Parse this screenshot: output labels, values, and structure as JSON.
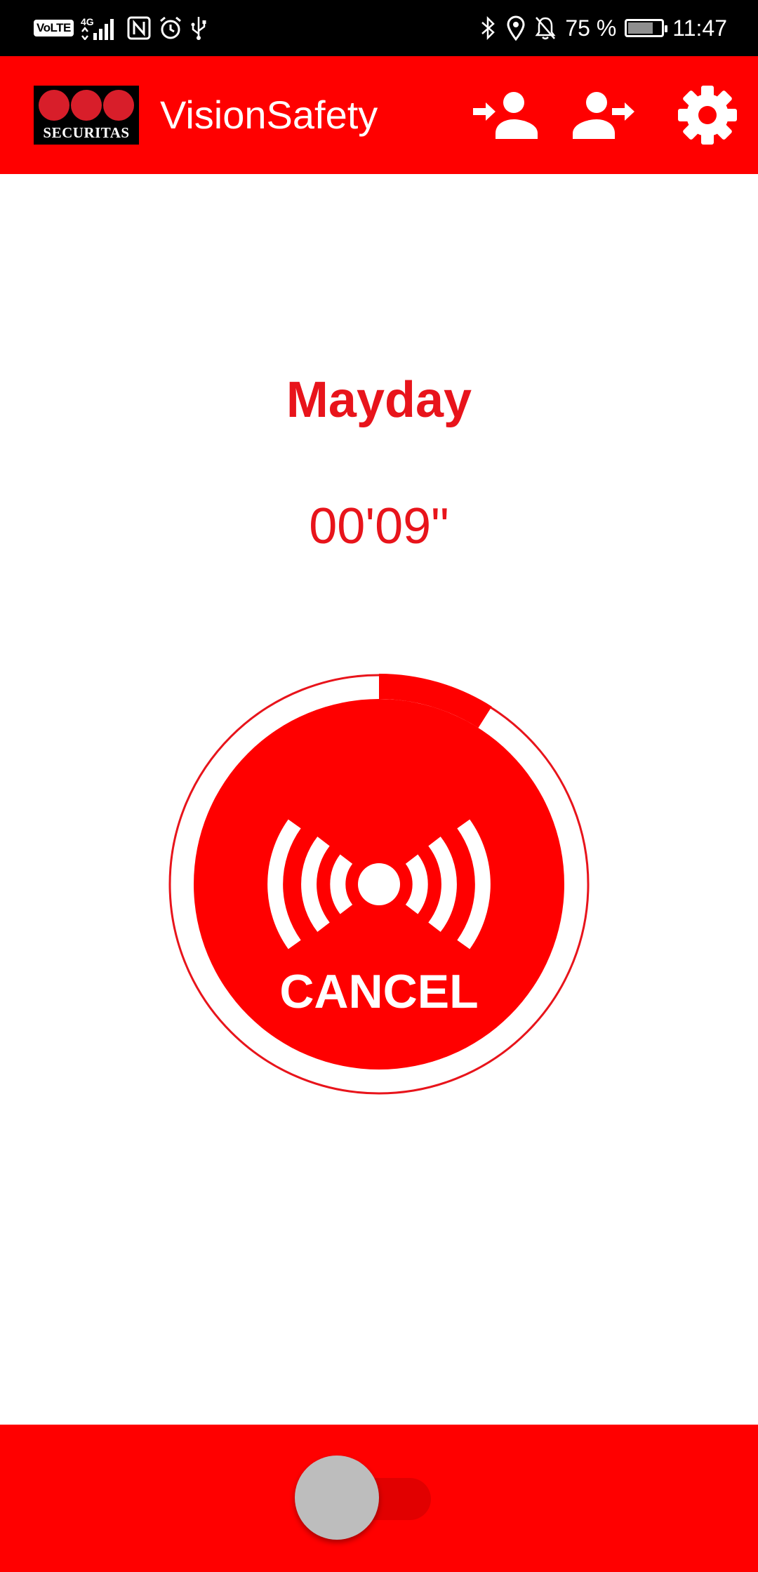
{
  "status_bar": {
    "volte": "VoLTE",
    "network": "4G",
    "battery_percent": "75 %",
    "battery_level": 0.75,
    "time": "11:47",
    "icons": [
      "signal-icon",
      "nfc-icon",
      "alarm-clock-icon",
      "usb-icon",
      "bluetooth-icon",
      "location-icon",
      "notifications-off-icon",
      "battery-charging-icon"
    ]
  },
  "app_bar": {
    "logo_text": "SECURITAS",
    "title": "VisionSafety",
    "actions": [
      "login-user-icon",
      "logout-user-icon",
      "settings-icon"
    ]
  },
  "alarm": {
    "title": "Mayday",
    "timer": "00'09\"",
    "cancel_label": "CANCEL",
    "progress": 0.09
  },
  "bottom_bar": {
    "toggle_on": false
  },
  "colors": {
    "brand_red": "#ff0000",
    "text_red": "#e8141b",
    "logo_red": "#d81e2a",
    "toggle_thumb": "#bdbdbd"
  }
}
